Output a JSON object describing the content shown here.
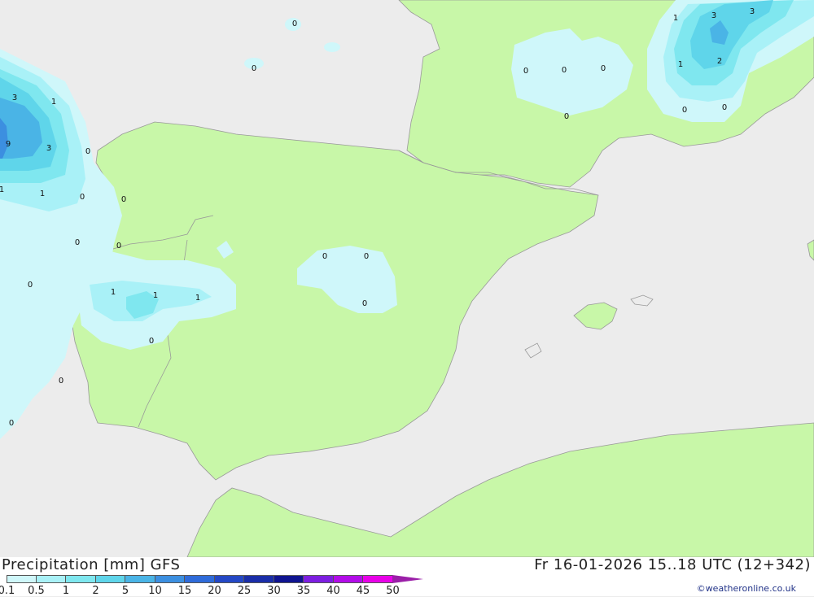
{
  "title": "Precipitation [mm] GFS",
  "timestamp": "Fr 16-01-2026 15..18 UTC (12+342)",
  "credit": "©weatheronline.co.uk",
  "scale": {
    "labels": [
      "0.1",
      "0.5",
      "1",
      "2",
      "5",
      "10",
      "15",
      "20",
      "25",
      "30",
      "35",
      "40",
      "45",
      "50"
    ],
    "colors": [
      "#cff7fa",
      "#a9f1f7",
      "#7fe7ef",
      "#5fd5ea",
      "#4ab4e6",
      "#3c8fe0",
      "#2f6bd9",
      "#2448c5",
      "#1a2ea8",
      "#0f1490",
      "#7d1ee0",
      "#b20ce8",
      "#e800e8",
      "#c21fc0"
    ]
  },
  "colors": {
    "land": "#c8f7a8",
    "sea": "#ececec",
    "border": "#999999"
  },
  "map_values": {
    "portugal_offshore": [
      "3",
      "1",
      "9",
      "3",
      "1",
      "1",
      "0",
      "0",
      "0",
      "0",
      "0",
      "0",
      "0",
      "0"
    ],
    "portugal_inland": [
      "1",
      "1",
      "1",
      "0"
    ],
    "bay_of_biscay": [
      "0",
      "0"
    ],
    "central_spain": [
      "0",
      "0",
      "0"
    ],
    "southern_france": [
      "0",
      "0",
      "0",
      "0"
    ],
    "alps": [
      "1",
      "3",
      "3",
      "1",
      "2",
      "0",
      "0"
    ]
  }
}
